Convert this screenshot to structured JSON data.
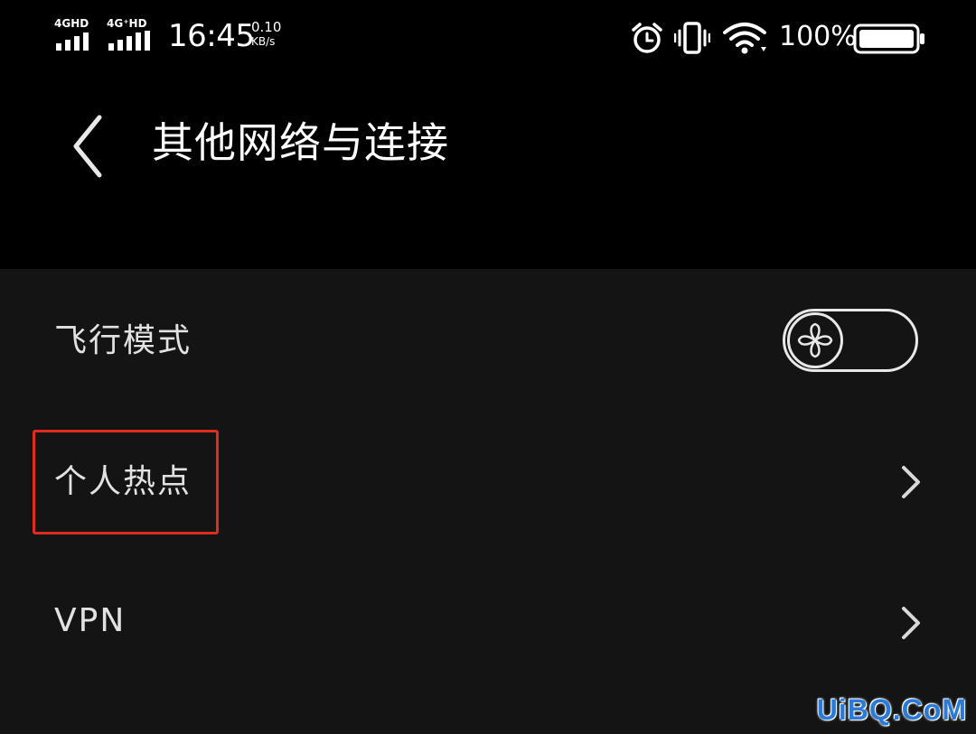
{
  "status_bar": {
    "sim1_label": "4GHD",
    "sim2_label": "4G⁺HD",
    "time": "16:45",
    "net_speed_value": "0.10",
    "net_speed_unit": "KB/s",
    "alarm_icon": "alarm-clock-icon",
    "vibrate_icon": "vibrate-icon",
    "wifi_icon": "wifi-icon",
    "battery_percent": "100%",
    "battery_level": 1.0
  },
  "header": {
    "back_icon": "chevron-left-icon",
    "title": "其他网络与连接"
  },
  "settings": [
    {
      "label": "飞行模式",
      "control": "toggle",
      "toggle_on": false
    },
    {
      "label": "个人热点",
      "control": "chevron",
      "highlighted": true
    },
    {
      "label": "VPN",
      "control": "chevron"
    }
  ],
  "watermark": "UiBQ.CoM",
  "colors": {
    "header_bg": "#000000",
    "list_bg": "#141414",
    "text": "#e2e2e2",
    "highlight": "#e02b20",
    "watermark": "#2a7bd8"
  }
}
